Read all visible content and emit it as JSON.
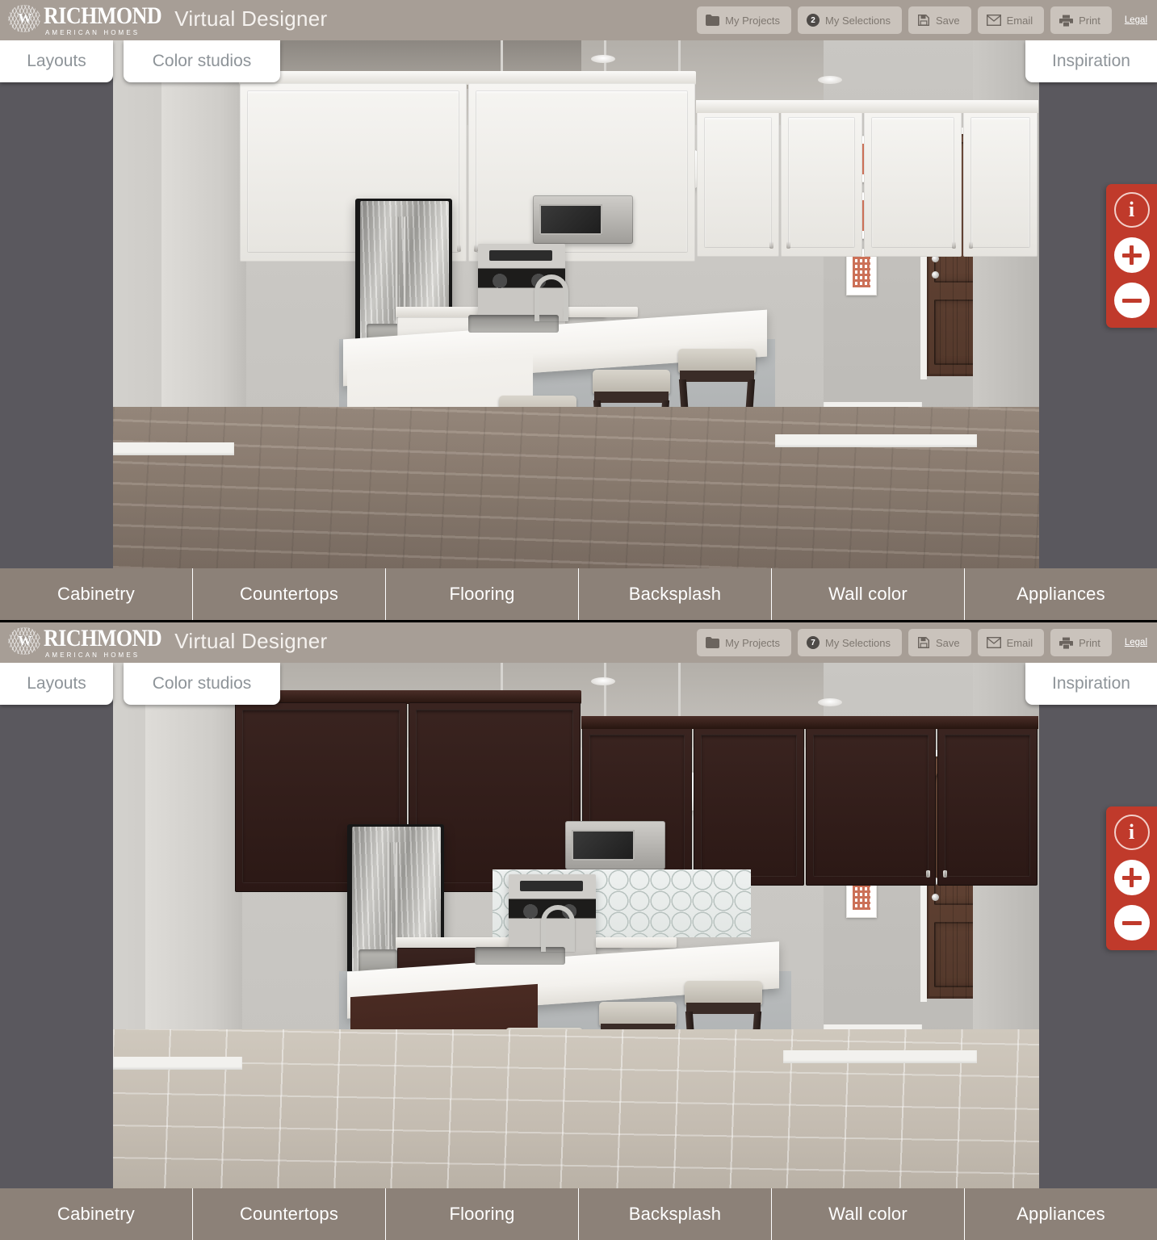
{
  "brand": {
    "name": "RICHMOND",
    "tagline": "AMERICAN HOMES",
    "crest_icon": "lion-crest-icon"
  },
  "header": {
    "app_title": "Virtual Designer",
    "legal_label": "Legal",
    "tools": [
      {
        "label": "My Projects",
        "icon": "folder-icon",
        "badge": null
      },
      {
        "label": "My Selections",
        "icon": "badge-count-icon",
        "badge": "2"
      },
      {
        "label": "Save",
        "icon": "floppy-disk-icon",
        "badge": null
      },
      {
        "label": "Email",
        "icon": "envelope-icon",
        "badge": null
      },
      {
        "label": "Print",
        "icon": "printer-icon",
        "badge": null
      }
    ],
    "tools_bottom": [
      {
        "label": "My Projects",
        "icon": "folder-icon",
        "badge": null
      },
      {
        "label": "My Selections",
        "icon": "badge-count-icon",
        "badge": "7"
      },
      {
        "label": "Save",
        "icon": "floppy-disk-icon",
        "badge": null
      },
      {
        "label": "Email",
        "icon": "envelope-icon",
        "badge": null
      },
      {
        "label": "Print",
        "icon": "printer-icon",
        "badge": null
      }
    ]
  },
  "tabs": {
    "layouts": "Layouts",
    "color_studios": "Color studios",
    "inspiration": "Inspiration"
  },
  "viewer_controls": {
    "info_label": "i",
    "zoom_in_label": "+",
    "zoom_out_label": "−",
    "accent_color": "#c03a2b"
  },
  "category_nav": [
    "Cabinetry",
    "Countertops",
    "Flooring",
    "Backsplash",
    "Wall color",
    "Appliances"
  ],
  "colors": {
    "header_bg": "#a79e96",
    "stage_bg": "#5a585e",
    "nav_bg": "#8c8178",
    "tab_bg": "#ffffff",
    "tab_text": "#8e9499",
    "accent_red": "#c03a2b",
    "tool_btn_bg": "#cac3bc"
  },
  "scenes": {
    "top": {
      "name": "kitchen-render-white-cabinets",
      "cabinetry": "White painted raised-panel cabinetry",
      "countertops": "White quartz",
      "flooring": "Gray-brown wood plank",
      "backsplash": "None (painted wall)",
      "wall_color": "Warm gray",
      "appliances": "Stainless steel"
    },
    "bottom": {
      "name": "kitchen-render-espresso-cabinets",
      "cabinetry": "Espresso stained cabinetry",
      "countertops": "White quartz",
      "flooring": "Light gray tile",
      "backsplash": "White arabesque tile",
      "wall_color": "Warm gray",
      "appliances": "Stainless steel"
    }
  }
}
